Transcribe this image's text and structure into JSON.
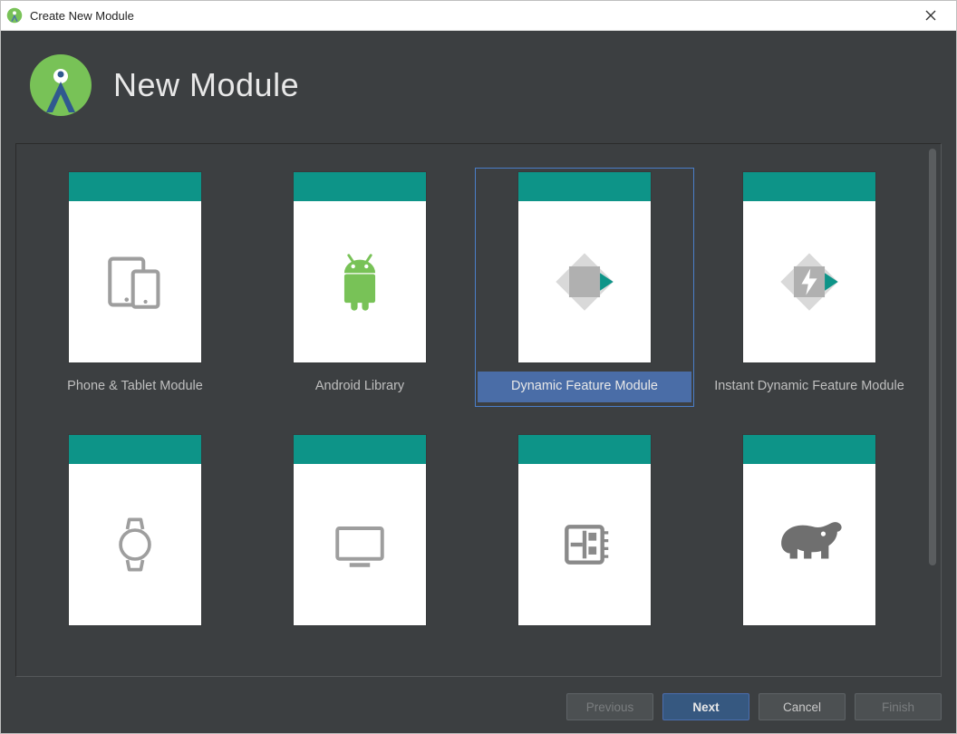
{
  "window": {
    "title": "Create New Module"
  },
  "header": {
    "title": "New Module"
  },
  "modules": [
    {
      "id": "phone-tablet",
      "label": "Phone & Tablet Module",
      "selected": false,
      "icon": "phone-tablet-icon"
    },
    {
      "id": "android-library",
      "label": "Android Library",
      "selected": false,
      "icon": "android-icon"
    },
    {
      "id": "dynamic-feature",
      "label": "Dynamic Feature Module",
      "selected": true,
      "icon": "dynamic-feature-icon"
    },
    {
      "id": "instant-dynamic",
      "label": "Instant Dynamic Feature Module",
      "selected": false,
      "icon": "instant-dynamic-icon"
    },
    {
      "id": "wear",
      "label": "",
      "selected": false,
      "icon": "watch-icon"
    },
    {
      "id": "tv",
      "label": "",
      "selected": false,
      "icon": "tv-icon"
    },
    {
      "id": "things",
      "label": "",
      "selected": false,
      "icon": "things-icon"
    },
    {
      "id": "gradle",
      "label": "",
      "selected": false,
      "icon": "elephant-icon"
    }
  ],
  "footer": {
    "previous": "Previous",
    "next": "Next",
    "cancel": "Cancel",
    "finish": "Finish",
    "previous_enabled": false,
    "next_enabled": true,
    "cancel_enabled": true,
    "finish_enabled": false
  },
  "colors": {
    "accent_teal": "#0d9488",
    "selection_blue": "#4a6da7",
    "android_green": "#78c257"
  }
}
